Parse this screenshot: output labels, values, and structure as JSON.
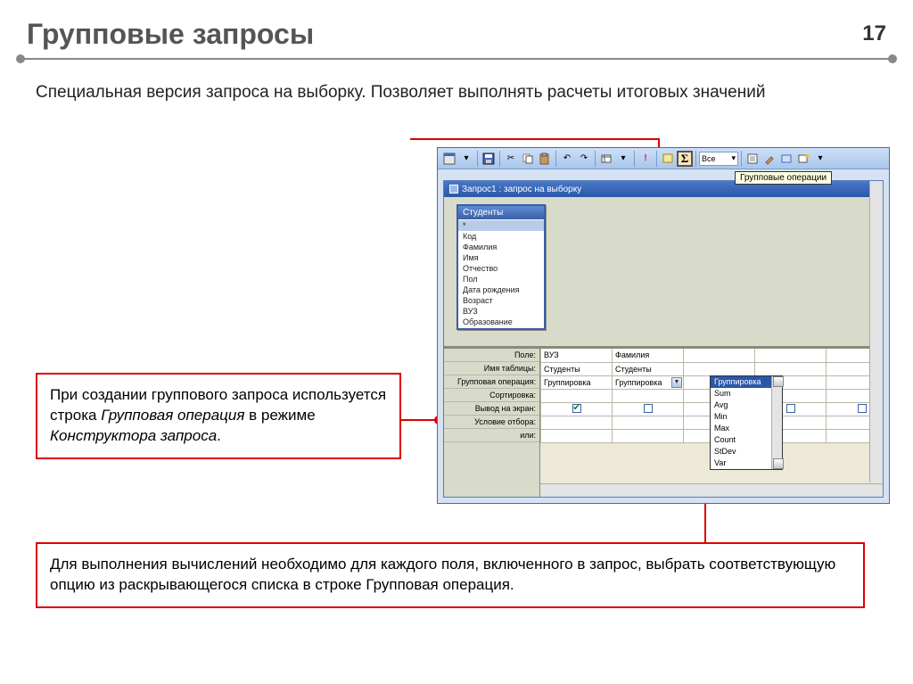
{
  "slide": {
    "title": "Групповые запросы",
    "page": "17",
    "intro": "Специальная версия запроса на выборку. Позволяет выполнять расчеты итоговых значений"
  },
  "callouts": {
    "mid_pre": "При создании группового запроса используется строка ",
    "mid_em": "Групповая операция",
    "mid_mid": " в режиме ",
    "mid_em2": "Конструктора запроса",
    "mid_post": ".",
    "bot": "Для выполнения вычислений необходимо для каждого поля, включенного в запрос, выбрать соответствующую опцию из раскрывающегося списка в строке Групповая операция."
  },
  "app": {
    "toolbar_combo": "Все",
    "tooltip": "Групповые операции",
    "window_title": "Запрос1 : запрос на выборку",
    "field_list_title": "Студенты",
    "fields": [
      "*",
      "Код",
      "Фамилия",
      "Имя",
      "Отчество",
      "Пол",
      "Дата рождения",
      "Возраст",
      "ВУЗ",
      "Образование"
    ],
    "row_labels": [
      "Поле:",
      "Имя таблицы:",
      "Групповая операция:",
      "Сортировка:",
      "Вывод на экран:",
      "Условие отбора:",
      "или:"
    ],
    "grid": {
      "col1": {
        "field": "ВУЗ",
        "table": "Студенты",
        "group": "Группировка"
      },
      "col2": {
        "field": "Фамилия",
        "table": "Студенты",
        "group": "Группировка"
      }
    },
    "dropdown": [
      "Группировка",
      "Sum",
      "Avg",
      "Min",
      "Max",
      "Count",
      "StDev",
      "Var"
    ]
  }
}
